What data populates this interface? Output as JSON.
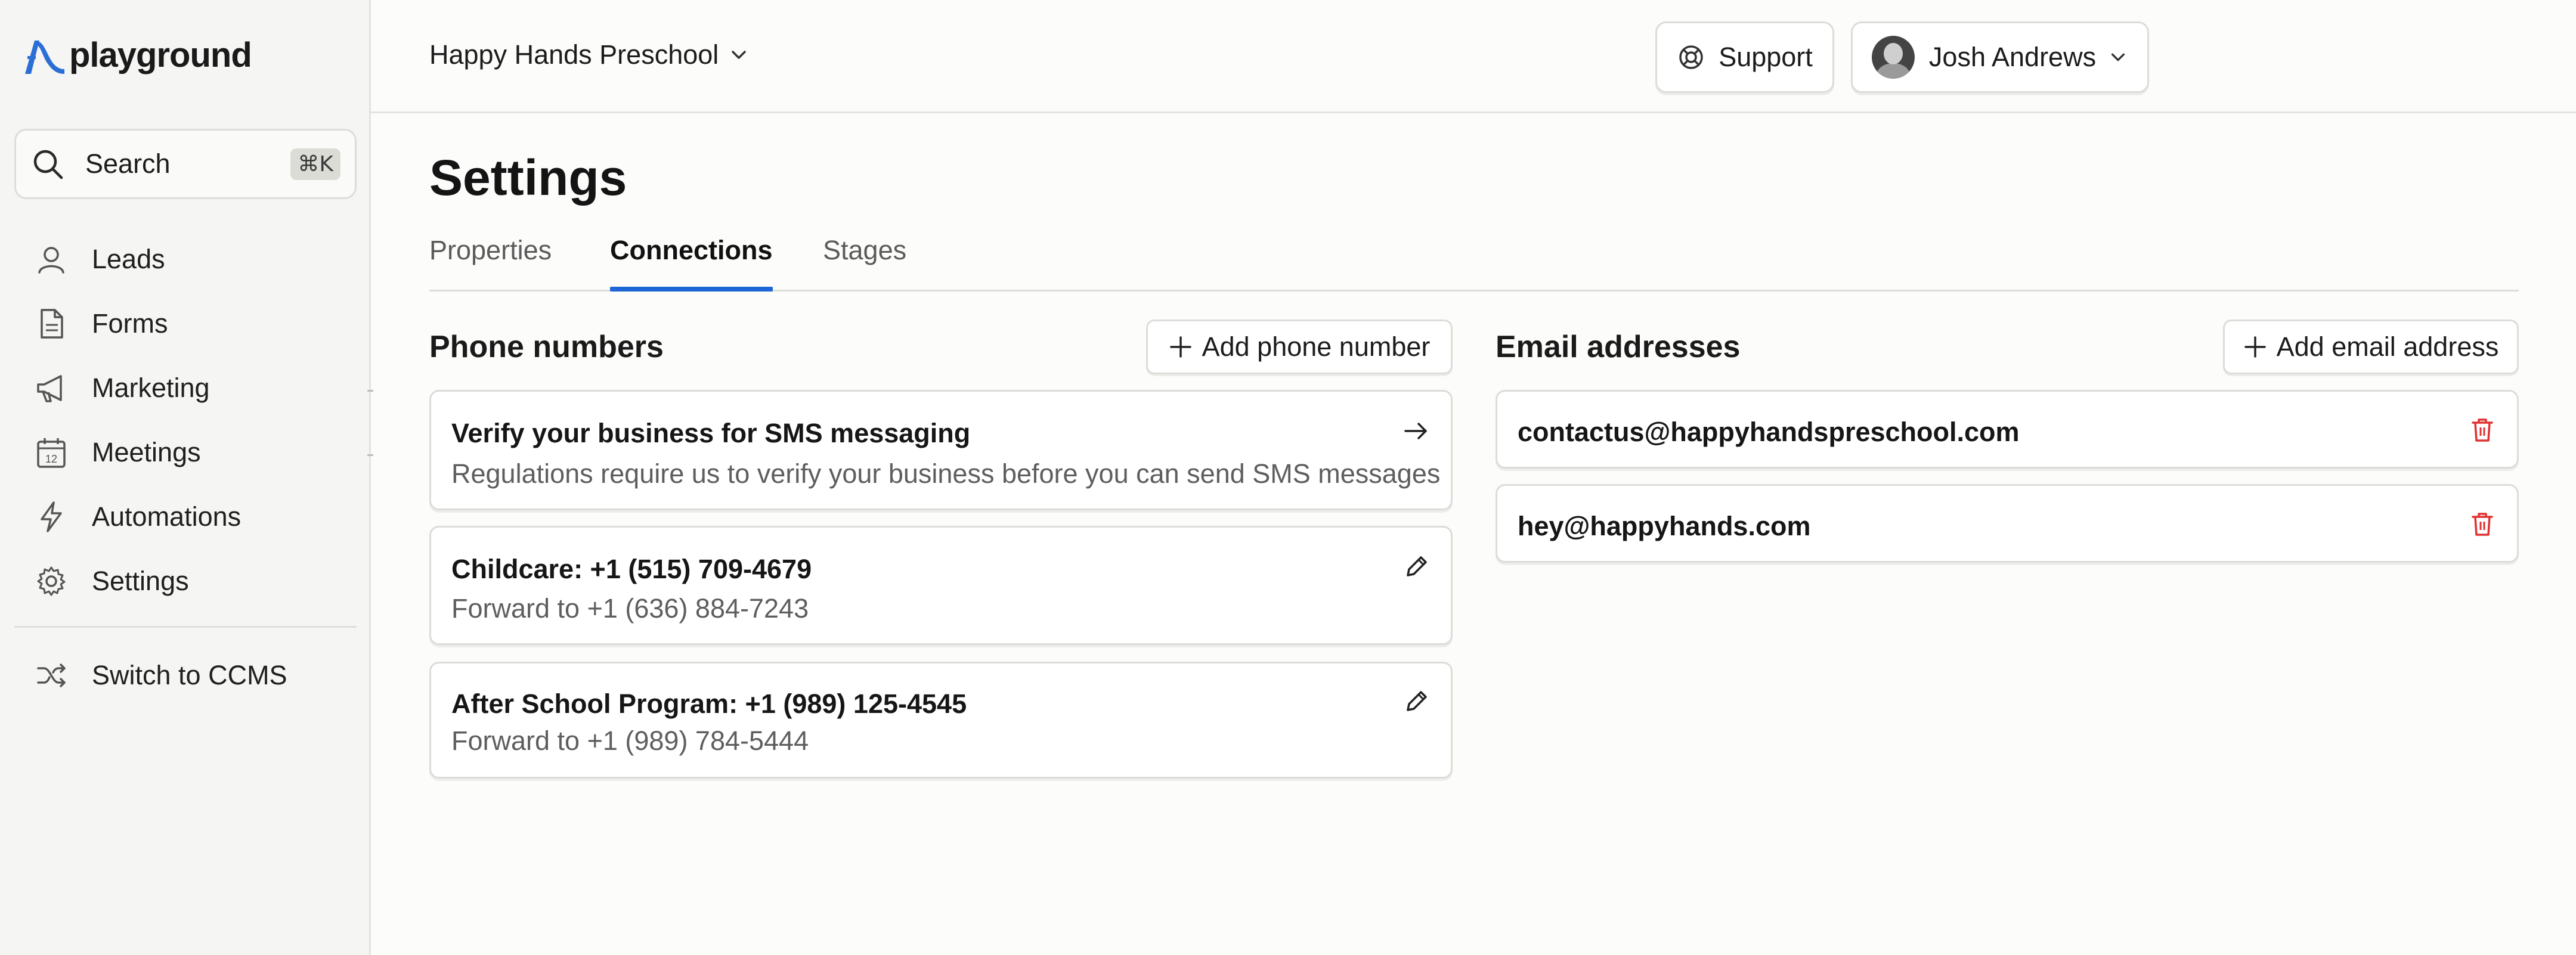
{
  "app": {
    "name": "playground"
  },
  "sidebar": {
    "search": {
      "label": "Search",
      "shortcut": "⌘K"
    },
    "items": [
      {
        "label": "Leads",
        "icon": "user-icon"
      },
      {
        "label": "Forms",
        "icon": "document-icon"
      },
      {
        "label": "Marketing",
        "icon": "megaphone-icon"
      },
      {
        "label": "Meetings",
        "icon": "calendar-icon"
      },
      {
        "label": "Automations",
        "icon": "lightning-icon"
      },
      {
        "label": "Settings",
        "icon": "gear-icon"
      }
    ],
    "switch": {
      "label": "Switch to CCMS",
      "icon": "shuffle-icon"
    },
    "calendar_day": "12"
  },
  "header": {
    "organization": "Happy Hands Preschool",
    "support_label": "Support",
    "user_name": "Josh Andrews"
  },
  "page": {
    "title": "Settings",
    "tabs": [
      {
        "label": "Properties",
        "active": false
      },
      {
        "label": "Connections",
        "active": true
      },
      {
        "label": "Stages",
        "active": false
      }
    ]
  },
  "phone": {
    "title": "Phone numbers",
    "add_label": "Add phone number",
    "verify": {
      "title": "Verify your business for SMS messaging",
      "subtitle": "Regulations require us to verify your business before you can send SMS messages"
    },
    "numbers": [
      {
        "title": "Childcare: +1 (515) 709-4679",
        "forward": "Forward to +1 (636) 884-7243"
      },
      {
        "title": "After School Program: +1 (989) 125-4545",
        "forward": "Forward to +1 (989) 784-5444"
      }
    ]
  },
  "email": {
    "title": "Email addresses",
    "add_label": "Add email address",
    "addresses": [
      "contactus@happyhandspreschool.com",
      "hey@happyhands.com"
    ]
  },
  "colors": {
    "accent": "#1d66d6",
    "logo_blue": "#2b6fd6",
    "delete_red": "#e03131",
    "sidebar_bg": "#f5f5f3",
    "page_bg": "#fcfcfb"
  }
}
